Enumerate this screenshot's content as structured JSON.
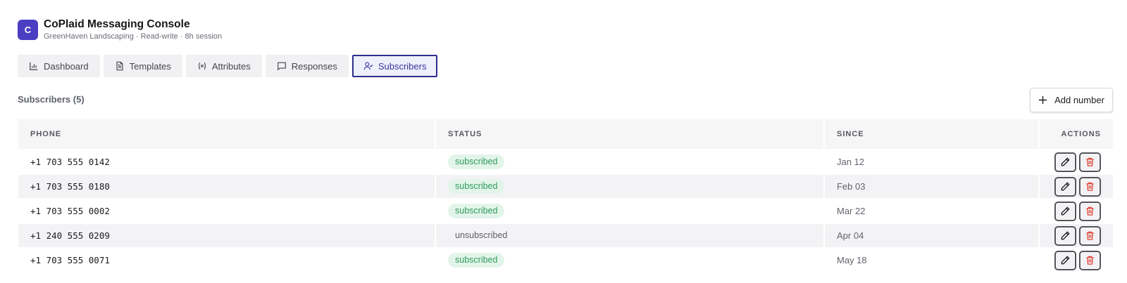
{
  "app": {
    "logo_letter": "C",
    "title": "CoPlaid Messaging Console",
    "subtitle": "GreenHaven Landscaping · Read-write · 8h session"
  },
  "tabs": [
    {
      "label": "Dashboard",
      "icon": "bar-chart-icon",
      "active": false
    },
    {
      "label": "Templates",
      "icon": "document-icon",
      "active": false
    },
    {
      "label": "Attributes",
      "icon": "variable-icon",
      "active": false
    },
    {
      "label": "Responses",
      "icon": "message-icon",
      "active": false
    },
    {
      "label": "Subscribers",
      "icon": "user-check-icon",
      "active": true
    }
  ],
  "section": {
    "title": "Subscribers (5)",
    "add_label": "Add number"
  },
  "table": {
    "headers": [
      "PHONE",
      "STATUS",
      "SINCE",
      "ACTIONS"
    ],
    "rows": [
      {
        "phone": "+1 703 555 0142",
        "status": "subscribed",
        "since": "Jan 12"
      },
      {
        "phone": "+1 703 555 0180",
        "status": "subscribed",
        "since": "Feb 03"
      },
      {
        "phone": "+1 703 555 0002",
        "status": "subscribed",
        "since": "Mar 22"
      },
      {
        "phone": "+1 240 555 0209",
        "status": "unsubscribed",
        "since": "Apr 04"
      },
      {
        "phone": "+1 703 555 0071",
        "status": "subscribed",
        "since": "May 18"
      }
    ]
  },
  "colors": {
    "accent": "#4a3fc2",
    "active_tab_border": "#2f2e8c",
    "subscribed_text": "#2f9a5c",
    "subscribed_bg": "#e3f5ea",
    "delete_icon": "#e0453a"
  }
}
